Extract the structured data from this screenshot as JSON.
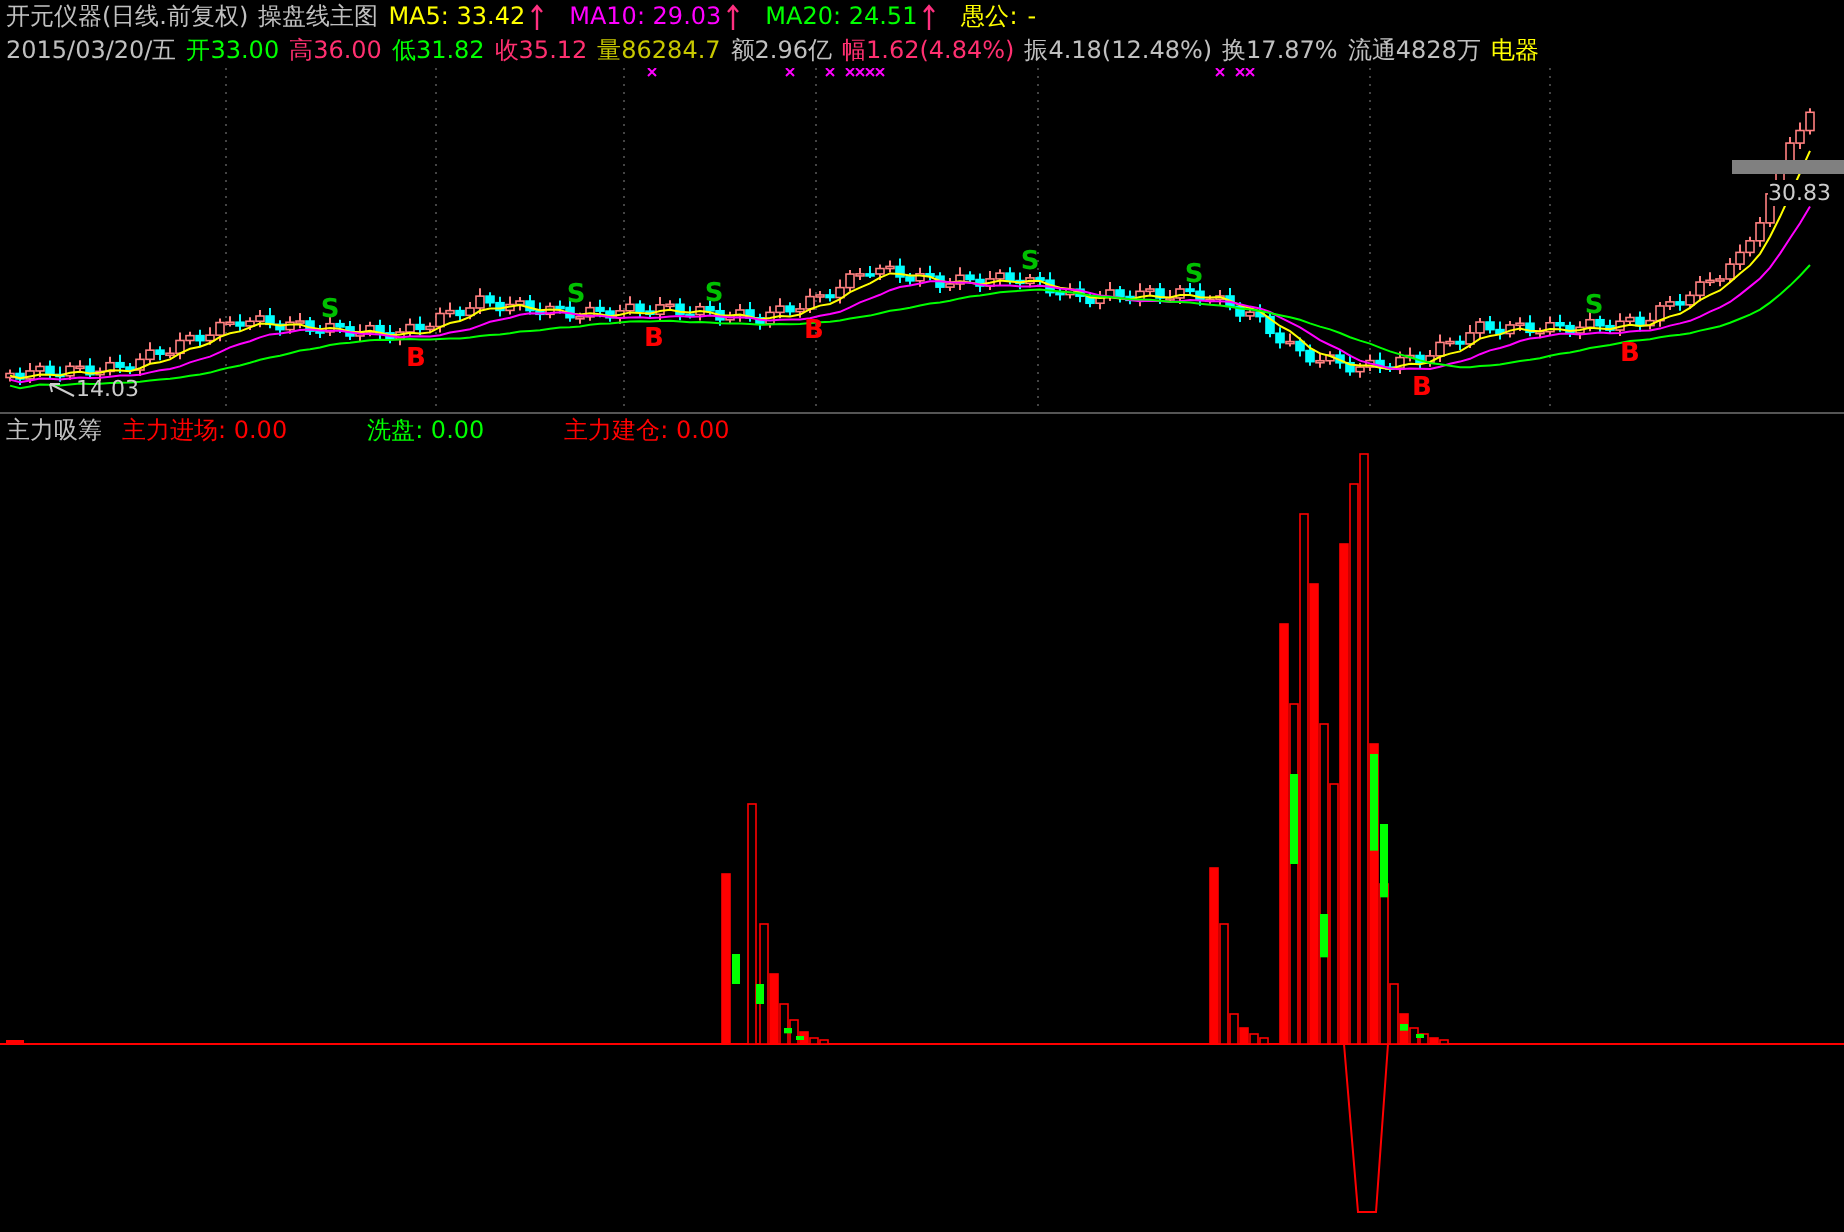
{
  "header": {
    "title": "开元仪器(日线.前复权)",
    "indicator": "操盘线主图",
    "moving_averages": [
      {
        "label": "MA5:",
        "value": "33.42",
        "color": "#ffff00"
      },
      {
        "label": "MA10:",
        "value": "29.03",
        "color": "#ff00ff"
      },
      {
        "label": "MA20:",
        "value": "24.51",
        "color": "#00ff00"
      }
    ],
    "extra_label": "愚公:",
    "extra_value": "-"
  },
  "quote": {
    "date": "2015/03/20/五",
    "fields": [
      {
        "label": "开",
        "value": "33.00",
        "color": "#00ff00"
      },
      {
        "label": "高",
        "value": "36.00",
        "color": "#ff3070"
      },
      {
        "label": "低",
        "value": "31.82",
        "color": "#00ff00"
      },
      {
        "label": "收",
        "value": "35.12",
        "color": "#ff3070"
      },
      {
        "label": "量",
        "value": "86284.7",
        "color": "#c8c800"
      },
      {
        "label": "额",
        "value": "2.96亿",
        "color": "#c0c0c0"
      },
      {
        "label": "幅",
        "value": "1.62(4.84%)",
        "color": "#ff3070"
      },
      {
        "label": "振",
        "value": "4.18(12.48%)",
        "color": "#c0c0c0"
      },
      {
        "label": "换",
        "value": "17.87%",
        "color": "#c0c0c0"
      },
      {
        "label": "流通",
        "value": "4828万",
        "color": "#c0c0c0"
      },
      {
        "label": "电器",
        "color": "#ffff00"
      }
    ]
  },
  "price_labels": [
    {
      "text": "14.03"
    },
    {
      "text": "30.83"
    }
  ],
  "signals": [
    {
      "kind": "sell",
      "label": "S"
    },
    {
      "kind": "buy",
      "label": "B"
    },
    {
      "kind": "sell",
      "label": "S"
    },
    {
      "kind": "buy",
      "label": "B"
    },
    {
      "kind": "sell",
      "label": "S"
    },
    {
      "kind": "buy",
      "label": "B"
    },
    {
      "kind": "sell",
      "label": "S"
    },
    {
      "kind": "sell",
      "label": "S"
    },
    {
      "kind": "buy",
      "label": "B"
    },
    {
      "kind": "sell",
      "label": "S"
    },
    {
      "kind": "buy",
      "label": "B"
    }
  ],
  "indicator_pane": {
    "name": "主力吸筹",
    "lines": [
      {
        "label": "主力进场:",
        "value": "0.00",
        "color": "#ff0000"
      },
      {
        "label": "洗盘:",
        "value": "0.00",
        "color": "#00ff00"
      },
      {
        "label": "主力建仓:",
        "value": "0.00",
        "color": "#ff0000"
      }
    ]
  }
}
